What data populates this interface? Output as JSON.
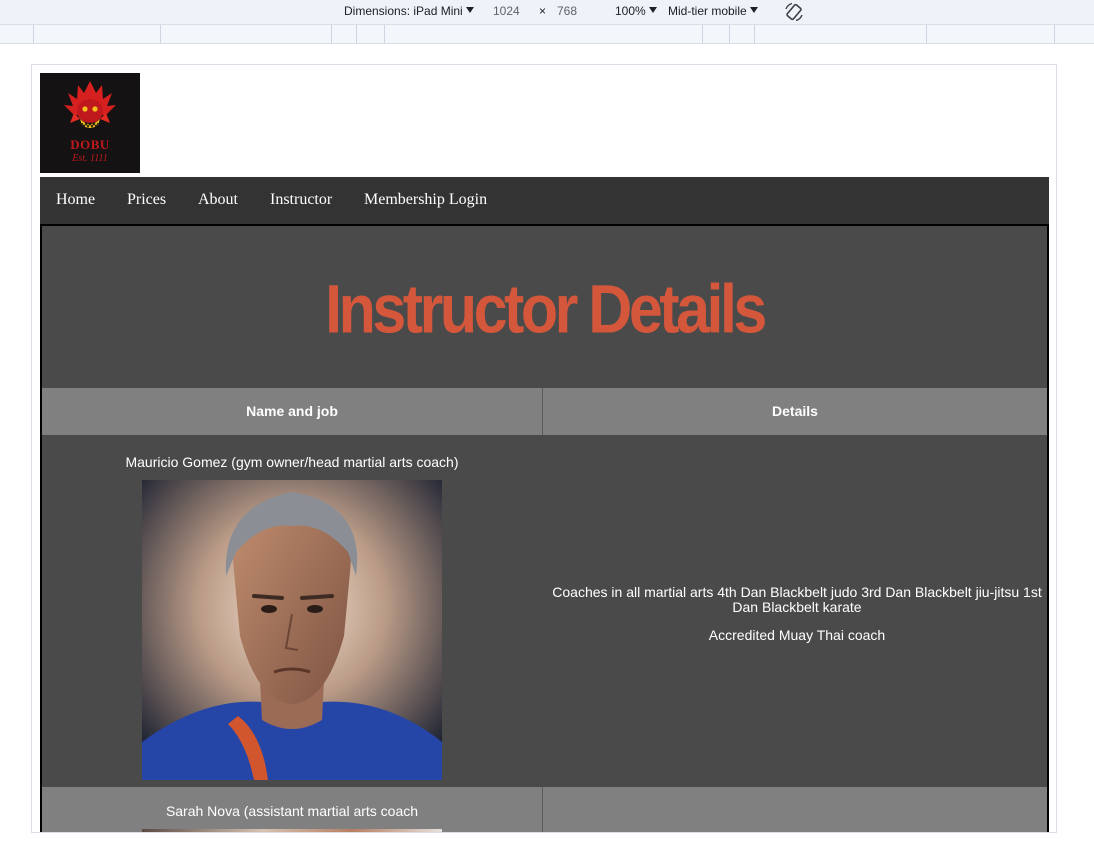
{
  "devtools": {
    "dimensions_label": "Dimensions: iPad Mini",
    "width": "1024",
    "times": "×",
    "height": "768",
    "zoom": "100%",
    "throttle": "Mid-tier mobile",
    "rotate_icon": "rotate-icon"
  },
  "logo": {
    "name": "DOBU",
    "est": "Est. 1111"
  },
  "nav": {
    "items": [
      "Home",
      "Prices",
      "About",
      "Instructor",
      "Membership Login"
    ]
  },
  "page": {
    "heading": "Instructor Details"
  },
  "table": {
    "headers": [
      "Name and job",
      "Details"
    ],
    "rows": [
      {
        "name": "Mauricio Gomez (gym owner/head martial arts coach)",
        "details": [
          "Coaches in all martial arts 4th Dan Blackbelt judo 3rd Dan Blackbelt jiu-jitsu 1st Dan Blackbelt karate",
          "Accredited Muay Thai coach"
        ]
      },
      {
        "name": "Sarah Nova (assistant martial arts coach",
        "details": []
      }
    ]
  },
  "colors": {
    "nav_bg": "#333333",
    "content_bg": "#4a4a4a",
    "header_bg": "#808080",
    "heading": "#d4573b"
  }
}
